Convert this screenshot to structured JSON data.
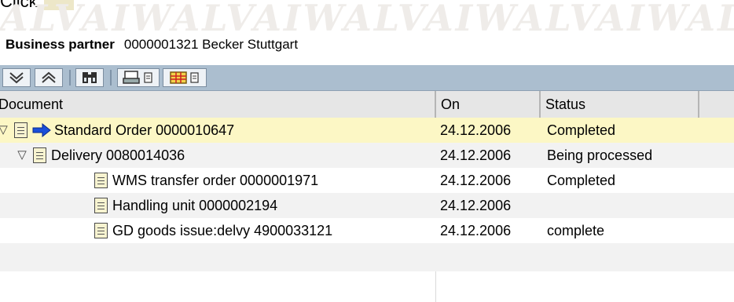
{
  "caption": {
    "text": "Click"
  },
  "watermark": {
    "text": "ALVAIWALVAIWALVAIWALVAIWALVAIW"
  },
  "business_partner": {
    "label": "Business partner",
    "value": "0000001321 Becker Stuttgart"
  },
  "toolbar": {
    "icons": [
      "expand-all-icon",
      "collapse-all-icon",
      "find-icon",
      "print-icon",
      "print-menu-icon",
      "layout-icon",
      "layout-menu-icon"
    ]
  },
  "grid": {
    "headers": {
      "document": "Document",
      "on": "On",
      "status": "Status"
    },
    "rows": [
      {
        "document": "Standard Order 0000010647",
        "on": "24.12.2006",
        "status": "Completed",
        "level": 0,
        "expanded": true,
        "current": true
      },
      {
        "document": "Delivery 0080014036",
        "on": "24.12.2006",
        "status": "Being processed",
        "level": 1,
        "expanded": true,
        "current": false
      },
      {
        "document": "WMS transfer order 0000001971",
        "on": "24.12.2006",
        "status": "Completed",
        "level": 2,
        "expanded": false,
        "current": false
      },
      {
        "document": "Handling unit 0000002194",
        "on": "24.12.2006",
        "status": "",
        "level": 2,
        "expanded": false,
        "current": false
      },
      {
        "document": "GD goods issue:delvy 4900033121",
        "on": "24.12.2006",
        "status": "complete",
        "level": 2,
        "expanded": false,
        "current": false
      }
    ]
  },
  "colors": {
    "highlight": "#fcf7c5",
    "toolbar": "#abbecf",
    "header": "#e6e6e6",
    "row_alt": "#f2f2f2"
  }
}
